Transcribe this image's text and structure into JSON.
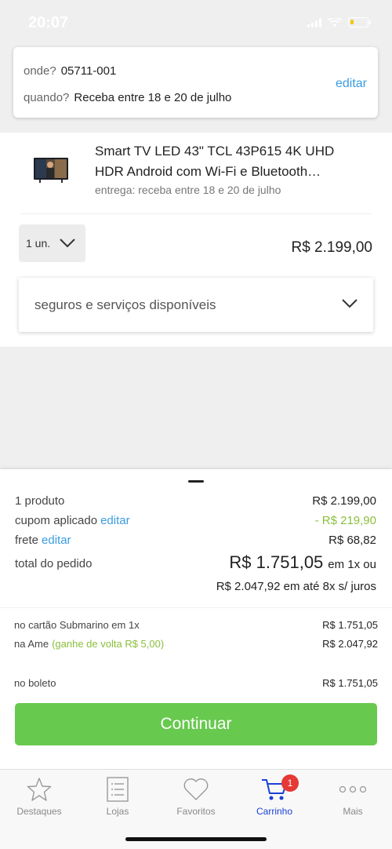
{
  "status_bar": {
    "time": "20:07"
  },
  "delivery": {
    "where_label": "onde?",
    "where_value": "05711-001",
    "when_label": "quando?",
    "when_value": "Receba entre 18 e 20 de julho",
    "edit_label": "editar"
  },
  "product": {
    "title": "Smart TV LED 43\" TCL 43P615 4K UHD HDR Android com Wi-Fi e Bluetooth…",
    "delivery_text": "entrega: receba entre 18 e 20 de julho",
    "quantity": "1 un.",
    "price": "R$ 2.199,00",
    "services_label": "seguros e serviços disponíveis"
  },
  "summary": {
    "products_label": "1 produto",
    "products_value": "R$ 2.199,00",
    "coupon_label": "cupom aplicado",
    "coupon_edit": "editar",
    "coupon_value": "- R$ 219,90",
    "shipping_label": "frete",
    "shipping_edit": "editar",
    "shipping_value": "R$ 68,82",
    "total_label": "total do pedido",
    "total_value": "R$ 1.751,05",
    "total_suffix": "em 1x ou",
    "installments": "R$ 2.047,92 em até 8x s/ juros"
  },
  "payment": {
    "card_label": "no cartão Submarino em 1x",
    "card_value": "R$ 1.751,05",
    "ame_label": "na Ame",
    "ame_cashback": "(ganhe de volta R$ 5,00)",
    "ame_value": "R$ 2.047,92",
    "boleto_label": "no boleto",
    "boleto_value": "R$ 1.751,05"
  },
  "continue_label": "Continuar",
  "tabs": [
    {
      "label": "Destaques",
      "icon": "star-icon"
    },
    {
      "label": "Lojas",
      "icon": "list-icon"
    },
    {
      "label": "Favoritos",
      "icon": "heart-icon"
    },
    {
      "label": "Carrinho",
      "icon": "cart-icon",
      "badge": "1",
      "active": true
    },
    {
      "label": "Mais",
      "icon": "more-icon"
    }
  ],
  "colors": {
    "accent_blue": "#3a9ce0",
    "active_tab": "#1c3fd6",
    "button_green": "#67c94e",
    "discount_green": "#8bbf3c",
    "badge_red": "#e53935"
  }
}
